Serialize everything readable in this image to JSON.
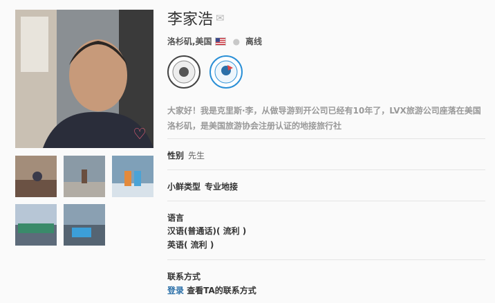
{
  "profile": {
    "name": "李家浩",
    "location": "洛杉矶,美国",
    "status": "离线",
    "badges": [
      {
        "name": "member-badge-icon",
        "text_top": "MEMBER",
        "text_bottom": "XIANXIAN.COM"
      },
      {
        "name": "expert-badge-icon",
        "text_top": "EXPERT",
        "text_bottom": "XIANXIAN.COM"
      }
    ],
    "bio": "大家好！我是克里斯·李，从做导游到开公司已经有10年了，LVX旅游公司座落在美国洛杉矶，是美国旅游协会注册认证的地接旅行社"
  },
  "fields": {
    "gender_label": "性别",
    "gender_value": "先生",
    "type_label": "小鲜类型",
    "type_value": "专业地接",
    "language_label": "语言",
    "languages": [
      "汉语(普通话)( 流利 )",
      "英语( 流利 )"
    ],
    "contact_label": "联系方式",
    "login_link": "登录",
    "contact_text": "查看TA的联系方式"
  },
  "colors": {
    "heart": "#f0627a",
    "link": "#2a6fa8",
    "badge_blue": "#2a8fd6"
  }
}
